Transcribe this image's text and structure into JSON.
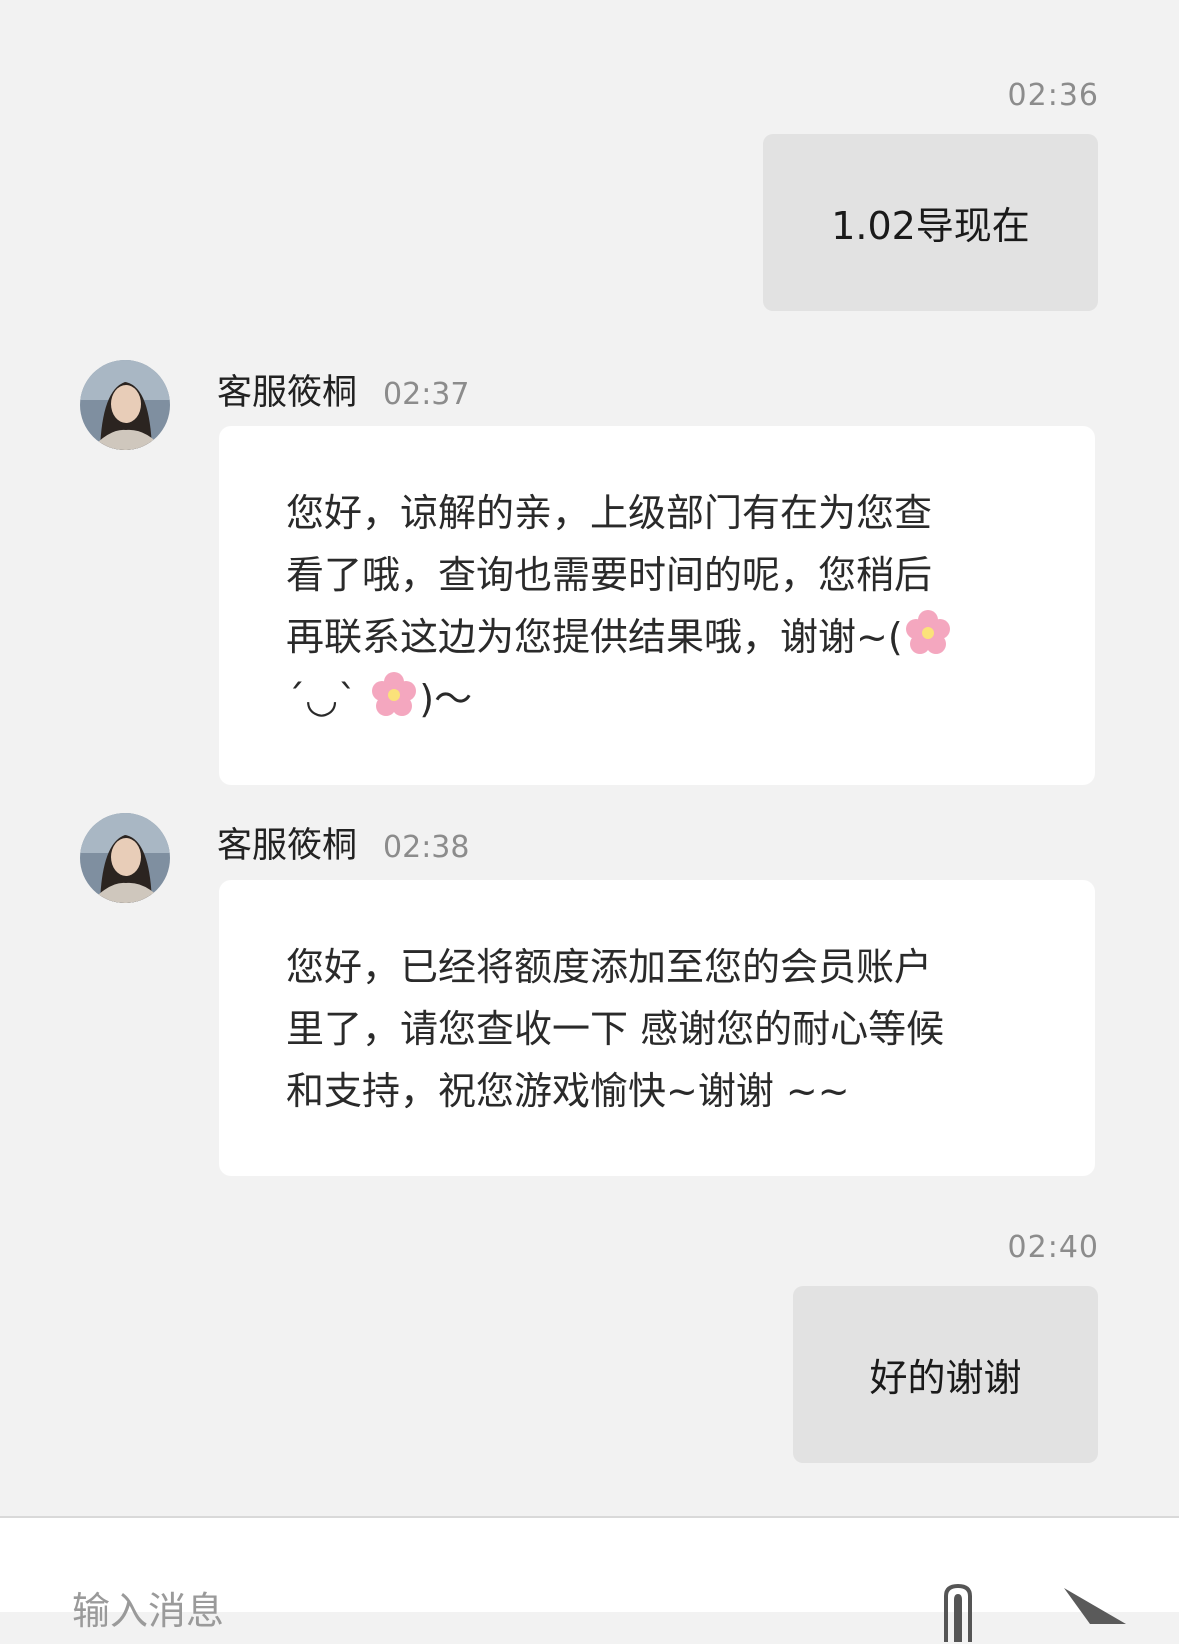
{
  "messages": [
    {
      "time": "02:36",
      "text": "1.02导现在"
    },
    {
      "sender": "客服筱桐",
      "time": "02:37",
      "lines": [
        "您好，谅解的亲，上级部门有在为您查",
        "看了哦，查询也需要时间的呢，您稍后",
        "再联系这边为您提供结果哦，谢谢~(",
        "´◡`",
        ")～"
      ]
    },
    {
      "sender": "客服筱桐",
      "time": "02:38",
      "lines": [
        "您好，已经将额度添加至您的会员账户",
        "里了，请您查收一下 感谢您的耐心等候",
        "和支持，祝您游戏愉快~谢谢 ~~"
      ]
    },
    {
      "time": "02:40",
      "text": "好的谢谢"
    }
  ],
  "input": {
    "placeholder": "输入消息"
  },
  "icons": {
    "attach": "paperclip-icon",
    "send": "send-arrow-icon",
    "avatar": "agent-avatar",
    "emoji": "cherry-blossom-emoji"
  }
}
